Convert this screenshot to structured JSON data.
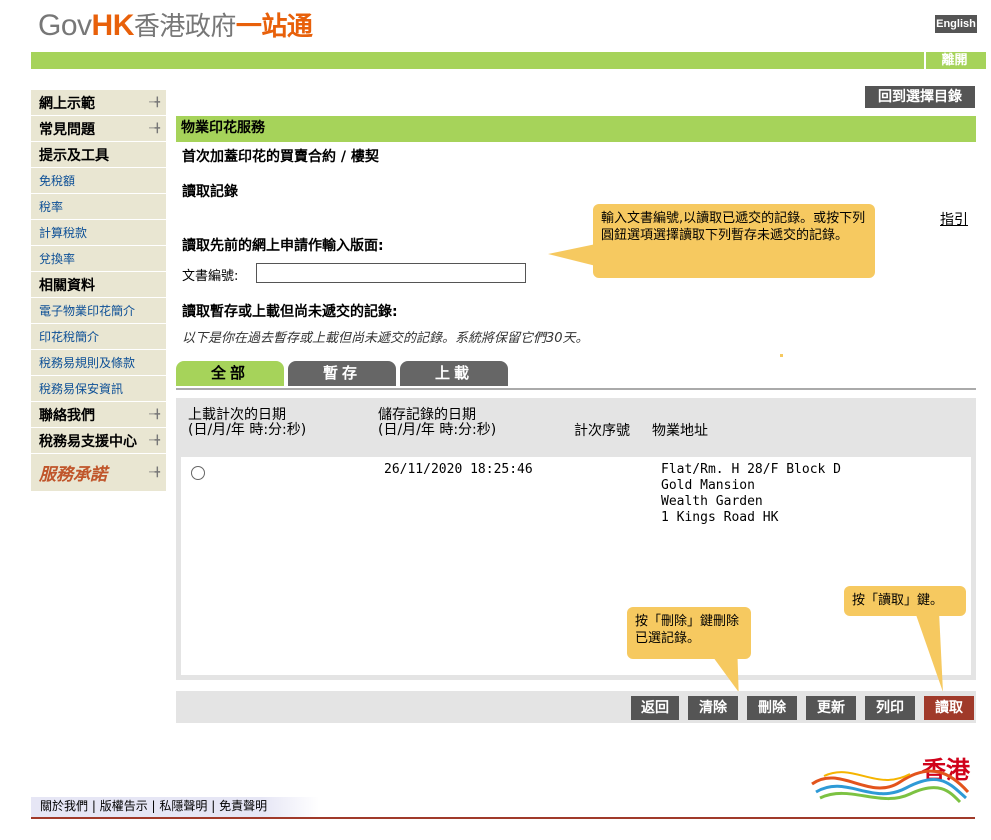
{
  "header": {
    "logo_gov": "Gov",
    "logo_hk": "HK",
    "logo_zh": "香港政府",
    "logo_zh2": "一站通",
    "lang_button": "English",
    "exit_button": "離開"
  },
  "sidebar": {
    "items": [
      {
        "label": "網上示範",
        "type": "head",
        "arrow": true
      },
      {
        "label": "常見問題",
        "type": "head",
        "arrow": true
      },
      {
        "label": "提示及工具",
        "type": "head",
        "arrow": false
      },
      {
        "label": "免稅額",
        "type": "link"
      },
      {
        "label": "稅率",
        "type": "link"
      },
      {
        "label": "計算稅款",
        "type": "link"
      },
      {
        "label": "兌換率",
        "type": "link"
      },
      {
        "label": "相關資料",
        "type": "head",
        "arrow": false
      },
      {
        "label": "電子物業印花簡介",
        "type": "link"
      },
      {
        "label": "印花稅簡介",
        "type": "link"
      },
      {
        "label": "稅務易規則及條款",
        "type": "link"
      },
      {
        "label": "稅務易保安資訊",
        "type": "link"
      },
      {
        "label": "聯絡我們",
        "type": "head",
        "arrow": true
      },
      {
        "label": "稅務易支援中心",
        "type": "head",
        "arrow": true
      }
    ],
    "brand": "服務承諾"
  },
  "main": {
    "back_to_menu": "回到選擇目錄",
    "section_title": "物業印花服務",
    "sub_title": "首次加蓋印花的買賣合約 / 樓契",
    "read_record_heading": "讀取記錄",
    "guide_link": "指引",
    "prev_form_label": "讀取先前的網上申請作輸入版面:",
    "doc_no_label": "文書編號:",
    "doc_no_value": "",
    "saved_heading": "讀取暫存或上載但尚未遞交的記錄:",
    "saved_note": "以下是你在過去暫存或上載但尚未遞交的記錄。系統將保留它們30天。",
    "tips": {
      "tip1": "輸入文書編號,以讀取已遞交的記錄。或按下列圓鈕選項選擇讀取下列暫存未遞交的記錄。",
      "tip2": "按「刪除」鍵刪除已選記錄。",
      "tip3": "按「讀取」鍵。"
    },
    "tabs": [
      "全部",
      "暫存",
      "上載"
    ],
    "table": {
      "headers": {
        "upload_date": "上載計次的日期",
        "upload_date_fmt": "(日/月/年 時:分:秒)",
        "save_date": "儲存記錄的日期",
        "save_date_fmt": "(日/月/年 時:分:秒)",
        "batch_no": "計次序號",
        "address": "物業地址"
      },
      "rows": [
        {
          "upload_date": "",
          "save_date": "26/11/2020 18:25:46",
          "batch_no": "",
          "address": [
            "Flat/Rm. H 28/F Block D",
            "Gold Mansion",
            "Wealth Garden",
            "1 Kings Road HK"
          ]
        }
      ]
    },
    "buttons": {
      "back": "返回",
      "clear": "清除",
      "delete": "刪除",
      "update": "更新",
      "print": "列印",
      "read": "讀取"
    }
  },
  "footer": {
    "links": [
      "關於我們",
      "版權告示",
      "私隱聲明",
      "免責聲明"
    ],
    "brand": "香港"
  },
  "colors": {
    "accent_green": "#a6d35a",
    "button_grey": "#555555",
    "button_read": "#a03a2a",
    "tip_yellow": "#f6c960",
    "logo_orange": "#e8600a"
  }
}
